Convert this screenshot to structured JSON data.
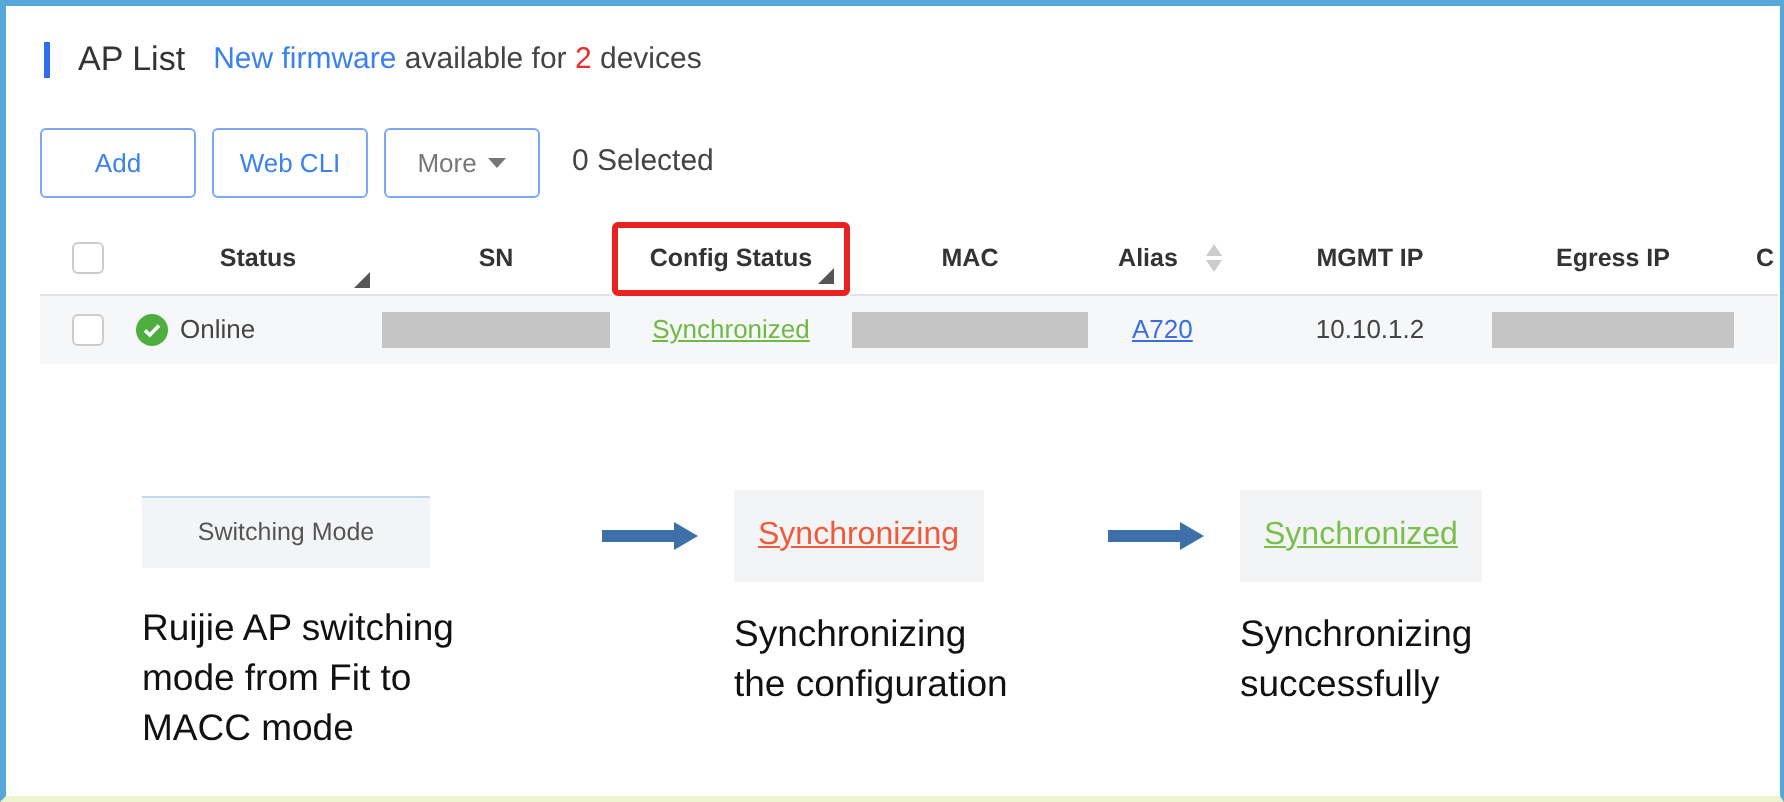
{
  "header": {
    "title": "AP List",
    "notice": [
      {
        "text": "New firmware",
        "kind": "link"
      },
      {
        "text": " available for ",
        "kind": "plain"
      },
      {
        "text": "2",
        "kind": "count"
      },
      {
        "text": " devices",
        "kind": "plain"
      }
    ]
  },
  "toolbar": {
    "buttons": [
      {
        "label": "Add",
        "kind": "primary"
      },
      {
        "label": "Web CLI",
        "kind": "primary"
      },
      {
        "label": "More",
        "kind": "dropdown"
      }
    ],
    "selected_count": "0 Selected"
  },
  "table": {
    "select_all": {
      "checked": false
    },
    "columns": [
      {
        "label": "Status",
        "resize_handle": true,
        "sort_arrows": false,
        "highlighted": false
      },
      {
        "label": "SN",
        "resize_handle": false,
        "sort_arrows": false,
        "highlighted": false
      },
      {
        "label": "Config Status",
        "resize_handle": true,
        "sort_arrows": false,
        "highlighted": true
      },
      {
        "label": "MAC",
        "resize_handle": false,
        "sort_arrows": false,
        "highlighted": false
      },
      {
        "label": "Alias",
        "resize_handle": false,
        "sort_arrows": true,
        "highlighted": false
      },
      {
        "label": "MGMT IP",
        "resize_handle": false,
        "sort_arrows": false,
        "highlighted": false
      },
      {
        "label": "Egress IP",
        "resize_handle": false,
        "sort_arrows": false,
        "highlighted": false
      },
      {
        "label": "C",
        "resize_handle": false,
        "sort_arrows": false,
        "highlighted": false
      }
    ],
    "rows": [
      {
        "checked": false,
        "cells": [
          {
            "kind": "status",
            "text": "Online"
          },
          {
            "kind": "redacted"
          },
          {
            "kind": "green-link",
            "text": "Synchronized"
          },
          {
            "kind": "redacted"
          },
          {
            "kind": "link",
            "text": "A720"
          },
          {
            "kind": "text",
            "text": "10.10.1.2"
          },
          {
            "kind": "redacted"
          },
          {
            "kind": "empty"
          }
        ]
      }
    ]
  },
  "steps": [
    {
      "chip": "Switching Mode",
      "kind": "button",
      "color": "#555555",
      "caption": "Ruijie AP switching\nmode from Fit to\nMACC mode"
    },
    {
      "chip": "Synchronizing",
      "kind": "link",
      "color": "#ef5a3a",
      "caption": "Synchronizing\nthe configuration"
    },
    {
      "chip": "Synchronized",
      "kind": "link",
      "color": "#78bf4c",
      "caption": "Synchronizing\nsuccessfully"
    }
  ]
}
